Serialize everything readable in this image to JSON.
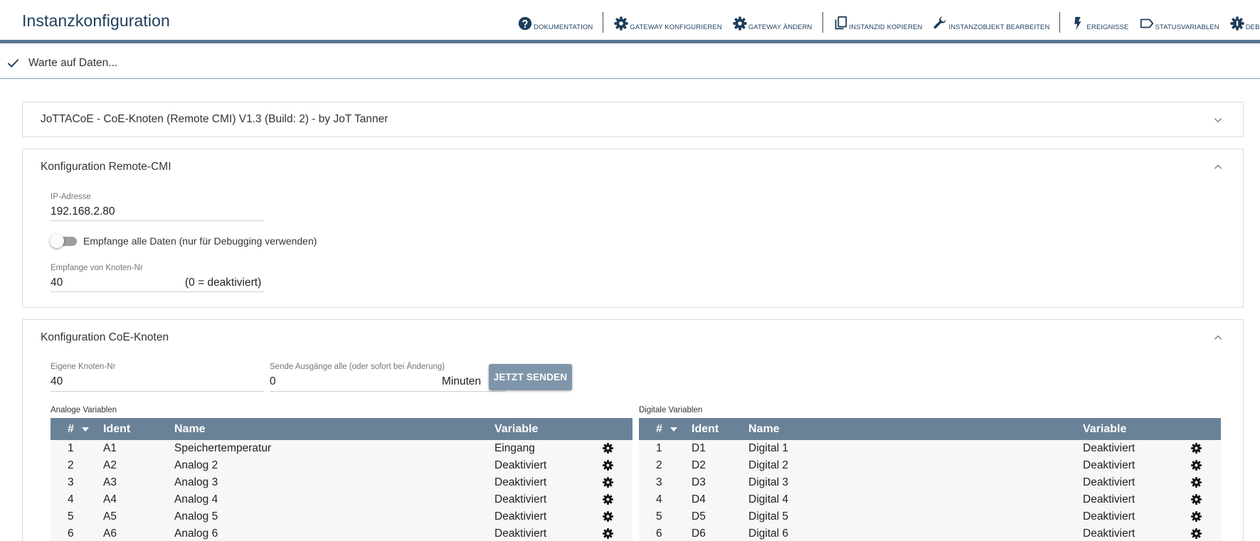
{
  "header": {
    "title": "Instanzkonfiguration",
    "toolbar": [
      {
        "icon": "help-circle-icon",
        "label": "Dokumentation"
      },
      {
        "icon": "gear-icon",
        "label": "Gateway konfigurieren"
      },
      {
        "icon": "gear-icon",
        "label": "Gateway ändern"
      },
      {
        "icon": "copy-icon",
        "label": "InstanzID kopieren"
      },
      {
        "icon": "wrench-icon",
        "label": "Instanzobjekt bearbeiten"
      },
      {
        "icon": "lightning-icon",
        "label": "Ereignisse"
      },
      {
        "icon": "tag-icon",
        "label": "Statusvariablen"
      },
      {
        "icon": "bug-icon",
        "label": "Debug"
      }
    ]
  },
  "status": {
    "icon": "check-icon",
    "text": "Warte auf Daten..."
  },
  "panels": {
    "info": {
      "title": "JoTTACoE - CoE-Knoten (Remote CMI) V1.3 (Build: 2) - by JoT Tanner",
      "expanded": false
    },
    "remote_cmi": {
      "title": "Konfiguration Remote-CMI",
      "expanded": true,
      "ip_label": "IP-Adresse",
      "ip_value": "192.168.2.80",
      "toggle_label": "Empfange alle Daten (nur für Debugging verwenden)",
      "toggle_on": false,
      "node_label": "Empfange von Knoten-Nr",
      "node_value": "40",
      "node_suffix": "(0 = deaktiviert)"
    },
    "coe_node": {
      "title": "Konfiguration CoE-Knoten",
      "expanded": true,
      "own_node_label": "Eigene Knoten-Nr",
      "own_node_value": "40",
      "send_label": "Sende Ausgänge alle (oder sofort bei Änderung)",
      "send_value": "0",
      "send_unit": "Minuten",
      "send_button": "Jetzt senden"
    }
  },
  "tables": {
    "analog": {
      "caption": "Analoge Variablen",
      "headers": [
        "#",
        "Ident",
        "Name",
        "Variable"
      ],
      "rows": [
        {
          "num": "1",
          "ident": "A1",
          "name": "Speichertemperatur",
          "variable": "Eingang"
        },
        {
          "num": "2",
          "ident": "A2",
          "name": "Analog 2",
          "variable": "Deaktiviert"
        },
        {
          "num": "3",
          "ident": "A3",
          "name": "Analog 3",
          "variable": "Deaktiviert"
        },
        {
          "num": "4",
          "ident": "A4",
          "name": "Analog 4",
          "variable": "Deaktiviert"
        },
        {
          "num": "5",
          "ident": "A5",
          "name": "Analog 5",
          "variable": "Deaktiviert"
        },
        {
          "num": "6",
          "ident": "A6",
          "name": "Analog 6",
          "variable": "Deaktiviert"
        }
      ]
    },
    "digital": {
      "caption": "Digitale Variablen",
      "headers": [
        "#",
        "Ident",
        "Name",
        "Variable"
      ],
      "rows": [
        {
          "num": "1",
          "ident": "D1",
          "name": "Digital 1",
          "variable": "Deaktiviert"
        },
        {
          "num": "2",
          "ident": "D2",
          "name": "Digital 2",
          "variable": "Deaktiviert"
        },
        {
          "num": "3",
          "ident": "D3",
          "name": "Digital 3",
          "variable": "Deaktiviert"
        },
        {
          "num": "4",
          "ident": "D4",
          "name": "Digital 4",
          "variable": "Deaktiviert"
        },
        {
          "num": "5",
          "ident": "D5",
          "name": "Digital 5",
          "variable": "Deaktiviert"
        },
        {
          "num": "6",
          "ident": "D6",
          "name": "Digital 6",
          "variable": "Deaktiviert"
        }
      ]
    }
  },
  "colors": {
    "title": "#1d3d5c",
    "header_rule": "#587693",
    "table_header": "#6a8297",
    "button": "#7f95aa",
    "row_bg": "#f7f7f7"
  }
}
